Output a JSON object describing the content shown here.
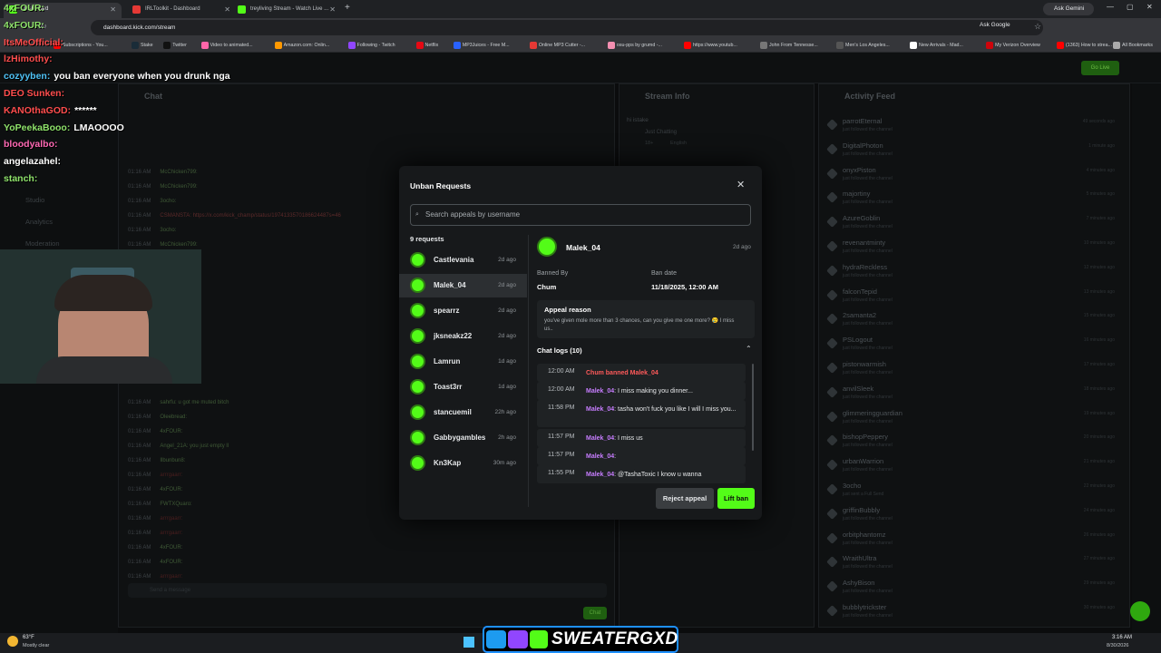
{
  "browser": {
    "tabs": [
      {
        "label": "Dashboard"
      },
      {
        "label": "IRLToolkit - Dashboard"
      },
      {
        "label": "treyliving Stream - Watch Live ..."
      }
    ],
    "url": "dashboard.kick.com/stream",
    "ask_google": "Ask Google",
    "ask_gemini": "Ask Gemini",
    "bookmarks": [
      "Subscriptions - You...",
      "Stake",
      "Twitter",
      "Video to animated...",
      "Amazon.com: Onlin...",
      "Following - Twitch",
      "Netflix",
      "MP3Juices - Free M...",
      "Online MP3 Cutter -...",
      "osu-pps by grumd -...",
      "https://www.youtub...",
      "John From Tennesse...",
      "Men's Los Angeles...",
      "New Arrivals - Mad...",
      "My Verizon Overview",
      "(1363) How to strea...",
      "All Bookmarks"
    ]
  },
  "dashboard": {
    "chat_title": "Chat",
    "stream_info_title": "Stream Info",
    "stream_info_text": "hi istake",
    "stream_category": "Just Chatting",
    "stream_tags": [
      "18+",
      "English"
    ],
    "activity_feed_title": "Activity Feed",
    "feed": [
      {
        "name": "parrotEternal",
        "sub": "just followed the channel",
        "time": "49 seconds ago"
      },
      {
        "name": "DigitalPhoton",
        "sub": "just followed the channel",
        "time": "1 minute ago"
      },
      {
        "name": "onyxPiston",
        "sub": "just followed the channel",
        "time": "4 minutes ago"
      },
      {
        "name": "majortiny",
        "sub": "just followed the channel",
        "time": "5 minutes ago"
      },
      {
        "name": "AzureGoblin",
        "sub": "just followed the channel",
        "time": "7 minutes ago"
      },
      {
        "name": "revenantminty",
        "sub": "just followed the channel",
        "time": "10 minutes ago"
      },
      {
        "name": "hydraReckless",
        "sub": "just followed the channel",
        "time": "12 minutes ago"
      },
      {
        "name": "falconTepid",
        "sub": "just followed the channel",
        "time": "13 minutes ago"
      },
      {
        "name": "2samanta2",
        "sub": "just followed the channel",
        "time": "15 minutes ago"
      },
      {
        "name": "PSLogout",
        "sub": "just followed the channel",
        "time": "16 minutes ago"
      },
      {
        "name": "pistonwarmish",
        "sub": "just followed the channel",
        "time": "17 minutes ago"
      },
      {
        "name": "anvilSleek",
        "sub": "just followed the channel",
        "time": "18 minutes ago"
      },
      {
        "name": "glimmeringguardian",
        "sub": "just followed the channel",
        "time": "19 minutes ago"
      },
      {
        "name": "bishopPeppery",
        "sub": "just followed the channel",
        "time": "20 minutes ago"
      },
      {
        "name": "urbanWarrion",
        "sub": "just followed the channel",
        "time": "21 minutes ago"
      },
      {
        "name": "3ocho",
        "sub": "just sent a Full Send",
        "time": "22 minutes ago"
      },
      {
        "name": "griffinBubbly",
        "sub": "just followed the channel",
        "time": "24 minutes ago"
      },
      {
        "name": "orbitphantomz",
        "sub": "just followed the channel",
        "time": "26 minutes ago"
      },
      {
        "name": "WraithUltra",
        "sub": "just followed the channel",
        "time": "27 minutes ago"
      },
      {
        "name": "AshyBison",
        "sub": "just followed the channel",
        "time": "29 minutes ago"
      },
      {
        "name": "bubblytrickster",
        "sub": "just followed the channel",
        "time": "30 minutes ago"
      }
    ],
    "chat_lines": [
      {
        "time": "01:16 AM",
        "user": "McChicken799:"
      },
      {
        "time": "01:16 AM",
        "user": "McChicken799:"
      },
      {
        "time": "01:16 AM",
        "user": "3ocho:"
      },
      {
        "time": "01:16 AM",
        "user": "CSMANSTA: https://x.com/kick_champ/status/1974133570186624487s=46"
      },
      {
        "time": "01:16 AM",
        "user": "3ocho:"
      },
      {
        "time": "01:16 AM",
        "user": "McChicken799:"
      },
      {
        "time": "01:16 AM",
        "user": "twn0o_oc:"
      },
      {
        "time": "01:16 AM",
        "user": "3ocho:"
      },
      {
        "time": "01:16 AM",
        "user": "twn0o_oc:"
      }
    ],
    "chat_lower": [
      {
        "time": "01:16 AM",
        "user": "sahrfu: u got me muted bitch"
      },
      {
        "time": "01:16 AM",
        "user": "Oleebread:"
      },
      {
        "time": "01:16 AM",
        "user": "4xFOUR:"
      },
      {
        "time": "01:16 AM",
        "user": "Angel_21A: you just empty ll"
      },
      {
        "time": "01:16 AM",
        "user": "Ilbunbun8:"
      },
      {
        "time": "01:16 AM",
        "user": "arrrgaarr:"
      },
      {
        "time": "01:16 AM",
        "user": "4xFOUR:"
      },
      {
        "time": "01:16 AM",
        "user": "FWTXQuaro:"
      },
      {
        "time": "01:16 AM",
        "user": "arrrgaarr:"
      },
      {
        "time": "01:16 AM",
        "user": "arrrgaarr:"
      },
      {
        "time": "01:16 AM",
        "user": "4xFOUR:"
      },
      {
        "time": "01:16 AM",
        "user": "4xFOUR:"
      },
      {
        "time": "01:16 AM",
        "user": "arrrgaarr:"
      }
    ],
    "sidebar": [
      "Studio",
      "Analytics",
      "Moderation"
    ],
    "send_placeholder": "Send a message",
    "chat_button": "Chat",
    "go_live": "Go Live"
  },
  "overlay_chat": [
    {
      "user": "4xFOUR:",
      "msg": "",
      "color": "#8fe36b"
    },
    {
      "user": "4xFOUR:",
      "msg": "",
      "color": "#8fe36b"
    },
    {
      "user": "ItsMeOfficial:",
      "msg": "",
      "color": "#ff4d4d"
    },
    {
      "user": "lzHimothy:",
      "msg": "",
      "color": "#ff4d4d"
    },
    {
      "user": "cozyyben:",
      "msg": "you ban everyone when you drunk nga",
      "color": "#4fc3f7"
    },
    {
      "user": "DEO Sunken:",
      "msg": "",
      "color": "#ff4d4d"
    },
    {
      "user": "KANOthaGOD:",
      "msg": "******",
      "color": "#ff4d4d"
    },
    {
      "user": "YoPeekaBooo:",
      "msg": "LMAOOOO",
      "color": "#8fe36b"
    },
    {
      "user": "bloodyalbo:",
      "msg": "",
      "color": "#ff69b4"
    },
    {
      "user": "angelazahel:",
      "msg": "",
      "color": "#ffffff"
    },
    {
      "user": "stanch:",
      "msg": "",
      "color": "#8fe36b"
    }
  ],
  "modal": {
    "title": "Unban Requests",
    "search_placeholder": "Search appeals by username",
    "count_label": "9 requests",
    "requests": [
      {
        "name": "Castlevania",
        "ago": "2d ago"
      },
      {
        "name": "Malek_04",
        "ago": "2d ago"
      },
      {
        "name": "spearrz",
        "ago": "2d ago"
      },
      {
        "name": "jksneakz22",
        "ago": "2d ago"
      },
      {
        "name": "Lamrun",
        "ago": "1d ago"
      },
      {
        "name": "Toast3rr",
        "ago": "1d ago"
      },
      {
        "name": "stancuemil",
        "ago": "22h ago"
      },
      {
        "name": "Gabbygambles",
        "ago": "2h ago"
      },
      {
        "name": "Kn3Kap",
        "ago": "30m ago"
      }
    ],
    "detail": {
      "username": "Malek_04",
      "ago": "2d ago",
      "banned_by_label": "Banned By",
      "banned_by": "Chum",
      "ban_date_label": "Ban date",
      "ban_date": "11/18/2025, 12:00 AM",
      "appeal_label": "Appeal reason",
      "appeal_text": "you've given mole more than 3 chances, can you give me one more? 😢 I miss us..",
      "logs_label": "Chat logs (10)",
      "logs": [
        {
          "time": "12:00 AM",
          "user": "Chum banned Malek_04",
          "msg": ""
        },
        {
          "time": "12:00 AM",
          "user": "Malek_04",
          "msg": ": I miss making you dinner..."
        },
        {
          "time": "11:58 PM",
          "user": "Malek_04",
          "msg": ": tasha won't fuck you like I will I miss you..."
        },
        {
          "time": "11:57 PM",
          "user": "Malek_04",
          "msg": ": I miss us"
        },
        {
          "time": "11:57 PM",
          "user": "Malek_04",
          "msg": ":"
        },
        {
          "time": "11:55 PM",
          "user": "Malek_04",
          "msg": ": @TashaToxic I know u wanna"
        }
      ],
      "reject_label": "Reject appeal",
      "lift_label": "Lift ban"
    }
  },
  "taskbar": {
    "temp": "63°F",
    "weather": "Mostly clear",
    "banner": "SWEATERGXD",
    "time": "3:16 AM",
    "date": "8/30/2026"
  }
}
